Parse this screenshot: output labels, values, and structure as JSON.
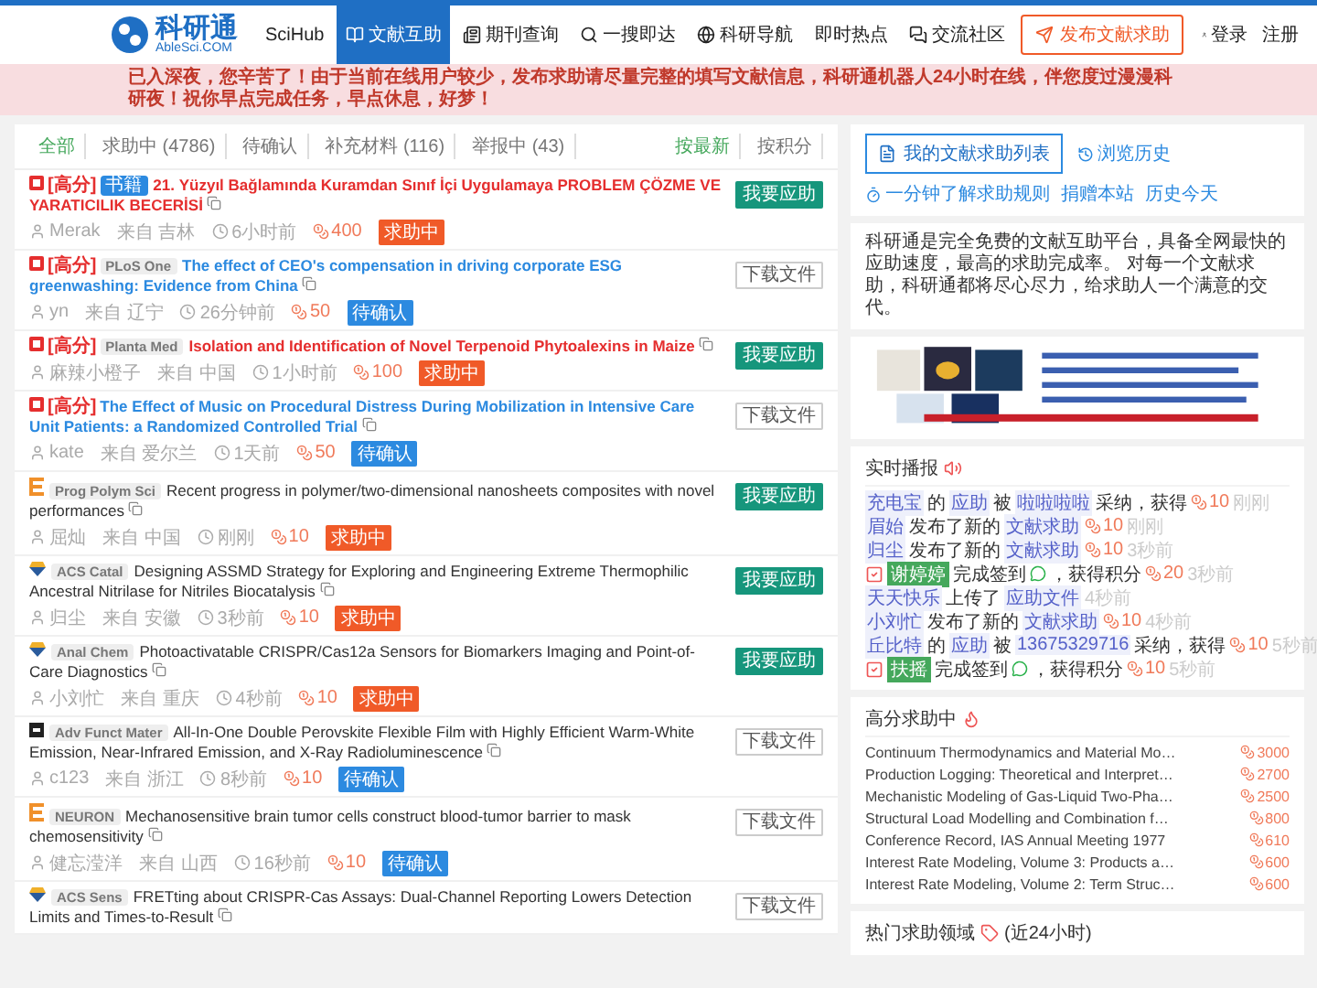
{
  "header": {
    "logo_name": "科研通",
    "logo_domain": "AbleSci.COM",
    "nav": [
      {
        "label": "SciHub",
        "selected": false
      },
      {
        "label": "文献互助",
        "selected": true
      },
      {
        "label": "期刊查询",
        "selected": false
      },
      {
        "label": "一搜即达",
        "selected": false
      },
      {
        "label": "科研导航",
        "selected": false
      },
      {
        "label": "即时热点",
        "selected": false
      },
      {
        "label": "交流社区",
        "selected": false
      }
    ],
    "publish_button": "发布文献求助",
    "login": "登录",
    "register": "注册"
  },
  "notice": "已入深夜，您辛苦了！由于当前在线用户较少，发布求助请尽量完整的填写文献信息，科研通机器人24小时在线，伴您度过漫漫科研夜！祝你早点完成任务，早点休息，好梦！",
  "filters": [
    {
      "label": "全部",
      "selected": true
    },
    {
      "label": "求助中 (4786)",
      "selected": false
    },
    {
      "label": "待确认",
      "selected": false
    },
    {
      "label": "补充材料 (116)",
      "selected": false
    },
    {
      "label": "举报中 (43)",
      "selected": false
    }
  ],
  "sort": [
    {
      "label": "按最新",
      "selected": true
    },
    {
      "label": "按积分",
      "selected": false
    }
  ],
  "requests": [
    {
      "high_label": "[高分]",
      "book_tag": "书籍",
      "title": "21. Yüzyıl Bağlamında Kuramdan Sınıf İçi Uygulamaya PROBLEM ÇÖZME VE YARATICILIK BECERİSİ",
      "user": "Merak",
      "location": "来自 吉林",
      "time": "6小时前",
      "points": "400",
      "status": {
        "kind": "open",
        "label": "求助中"
      },
      "action": {
        "kind": "respond",
        "label": "我要应助"
      }
    },
    {
      "high_label": "[高分]",
      "journal": "PLoS One",
      "title": "The effect of CEO's compensation in driving corporate ESG greenwashing: Evidence from China",
      "user": "yn",
      "location": "来自 辽宁",
      "time": "26分钟前",
      "points": "50",
      "status": {
        "kind": "pending",
        "label": "待确认"
      },
      "action": {
        "kind": "download",
        "label": "下载文件"
      }
    },
    {
      "high_label": "[高分]",
      "journal": "Planta Med",
      "title": "Isolation and Identification of Novel Terpenoid Phytoalexins in Maize",
      "user": "麻辣小橙子",
      "location": "来自 中国",
      "time": "1小时前",
      "points": "100",
      "status": {
        "kind": "open",
        "label": "求助中"
      },
      "action": {
        "kind": "respond",
        "label": "我要应助"
      }
    },
    {
      "high_label": "[高分]",
      "title": "The Effect of Music on Procedural Distress During Mobilization in Intensive Care Unit Patients: a Randomized Controlled Trial",
      "user": "kate",
      "location": "来自 爱尔兰",
      "time": "1天前",
      "points": "50",
      "status": {
        "kind": "pending",
        "label": "待确认"
      },
      "action": {
        "kind": "download",
        "label": "下载文件"
      }
    },
    {
      "journal": "Prog Polym Sci",
      "title": "Recent progress in polymer/two-dimensional nanosheets composites with novel performances",
      "user": "屈灿",
      "location": "来自 中国",
      "time": "刚刚",
      "points": "10",
      "status": {
        "kind": "open",
        "label": "求助中"
      },
      "action": {
        "kind": "respond",
        "label": "我要应助"
      }
    },
    {
      "journal": "ACS Catal",
      "title": "Designing ASSMD Strategy for Exploring and Engineering Extreme Thermophilic Ancestral Nitrilase for Nitriles Biocatalysis",
      "user": "归尘",
      "location": "来自 安徽",
      "time": "3秒前",
      "points": "10",
      "status": {
        "kind": "open",
        "label": "求助中"
      },
      "action": {
        "kind": "respond",
        "label": "我要应助"
      }
    },
    {
      "journal": "Anal Chem",
      "title": "Photoactivatable CRISPR/Cas12a Sensors for Biomarkers Imaging and Point-of-Care Diagnostics",
      "user": "小刘忙",
      "location": "来自 重庆",
      "time": "4秒前",
      "points": "10",
      "status": {
        "kind": "open",
        "label": "求助中"
      },
      "action": {
        "kind": "respond",
        "label": "我要应助"
      }
    },
    {
      "journal": "Adv Funct Mater",
      "title": "All-In-One Double Perovskite Flexible Film with Highly Efficient Warm-White Emission, Near-Infrared Emission, and X-Ray Radioluminescence",
      "user": "c123",
      "location": "来自 浙江",
      "time": "8秒前",
      "points": "10",
      "status": {
        "kind": "pending",
        "label": "待确认"
      },
      "action": {
        "kind": "download",
        "label": "下载文件"
      }
    },
    {
      "journal": "NEURON",
      "title": "Mechanosensitive brain tumor cells construct blood-tumor barrier to mask chemosensitivity",
      "user": "健忘滢洋",
      "location": "来自 山西",
      "time": "16秒前",
      "points": "10",
      "status": {
        "kind": "pending",
        "label": "待确认"
      },
      "action": {
        "kind": "download",
        "label": "下载文件"
      }
    },
    {
      "journal": "ACS Sens",
      "title": "FRETting about CRISPR-Cas Assays: Dual-Channel Reporting Lowers Detection Limits and Times-to-Result",
      "action": {
        "kind": "download",
        "label": "下载文件"
      }
    }
  ],
  "side": {
    "my_list_button": "我的文献求助列表",
    "history_link": "浏览历史",
    "links": [
      "一分钟了解求助规则",
      "捐赠本站",
      "历史今天"
    ],
    "intro": "科研通是完全免费的文献互助平台，具备全网最快的应助速度，最高的求助完成率。 对每一个文献求助，科研通都将尽心尽力，给求助人一个满意的交代。",
    "banner": {
      "kind": "picture"
    },
    "feed_title": "实时播报",
    "feed": [
      [
        {
          "kind": "user",
          "text": "充电宝"
        },
        {
          "kind": "text",
          "text": "的"
        },
        {
          "kind": "user",
          "text": "应助"
        },
        {
          "kind": "text",
          "text": "被"
        },
        {
          "kind": "user",
          "text": "啦啦啦啦"
        },
        {
          "kind": "text",
          "text": "采纳，获得"
        },
        {
          "kind": "points",
          "text": "10"
        },
        {
          "kind": "time",
          "text": "刚刚"
        }
      ],
      [
        {
          "kind": "user",
          "text": "眉始"
        },
        {
          "kind": "text",
          "text": "发布了新的"
        },
        {
          "kind": "user",
          "text": "文献求助"
        },
        {
          "kind": "points",
          "text": "10"
        },
        {
          "kind": "time",
          "text": "刚刚"
        }
      ],
      [
        {
          "kind": "user",
          "text": "归尘"
        },
        {
          "kind": "text",
          "text": "发布了新的"
        },
        {
          "kind": "user",
          "text": "文献求助"
        },
        {
          "kind": "points",
          "text": "10"
        },
        {
          "kind": "time",
          "text": "3秒前"
        }
      ],
      [
        {
          "kind": "check"
        },
        {
          "kind": "badge",
          "text": "谢婷婷"
        },
        {
          "kind": "text",
          "text": "完成签到"
        },
        {
          "kind": "sign"
        },
        {
          "kind": "text",
          "text": "，获得积分"
        },
        {
          "kind": "points",
          "text": "20"
        },
        {
          "kind": "time",
          "text": "3秒前"
        }
      ],
      [
        {
          "kind": "user",
          "text": "天天快乐"
        },
        {
          "kind": "text",
          "text": "上传了"
        },
        {
          "kind": "user",
          "text": "应助文件"
        },
        {
          "kind": "time",
          "text": "4秒前"
        }
      ],
      [
        {
          "kind": "user",
          "text": "小刘忙"
        },
        {
          "kind": "text",
          "text": "发布了新的"
        },
        {
          "kind": "user",
          "text": "文献求助"
        },
        {
          "kind": "points",
          "text": "10"
        },
        {
          "kind": "time",
          "text": "4秒前"
        }
      ],
      [
        {
          "kind": "user",
          "text": "丘比特"
        },
        {
          "kind": "text",
          "text": "的"
        },
        {
          "kind": "user",
          "text": "应助"
        },
        {
          "kind": "text",
          "text": "被"
        },
        {
          "kind": "user",
          "text": "13675329716"
        },
        {
          "kind": "text",
          "text": "采纳，获得"
        },
        {
          "kind": "points",
          "text": "10"
        },
        {
          "kind": "time",
          "text": "5秒前"
        }
      ],
      [
        {
          "kind": "check"
        },
        {
          "kind": "badge",
          "text": "扶摇"
        },
        {
          "kind": "text",
          "text": "完成签到"
        },
        {
          "kind": "sign"
        },
        {
          "kind": "text",
          "text": "，获得积分"
        },
        {
          "kind": "points",
          "text": "10"
        },
        {
          "kind": "time",
          "text": "5秒前"
        }
      ]
    ],
    "high_title": "高分求助中",
    "high": [
      {
        "title": "Continuum Thermodynamics and Material Mo…",
        "points": "3000"
      },
      {
        "title": "Production Logging: Theoretical and Interpret…",
        "points": "2700"
      },
      {
        "title": "Mechanistic Modeling of Gas-Liquid Two-Pha…",
        "points": "2500"
      },
      {
        "title": "Structural Load Modelling and Combination f…",
        "points": "800"
      },
      {
        "title": "Conference Record, IAS Annual Meeting 1977",
        "points": "610"
      },
      {
        "title": "Interest Rate Modeling, Volume 3: Products a…",
        "points": "600"
      },
      {
        "title": "Interest Rate Modeling, Volume 2: Term Struc…",
        "points": "600"
      }
    ],
    "fields_title": "热门求助领域",
    "fields_note": "(近24小时)"
  }
}
